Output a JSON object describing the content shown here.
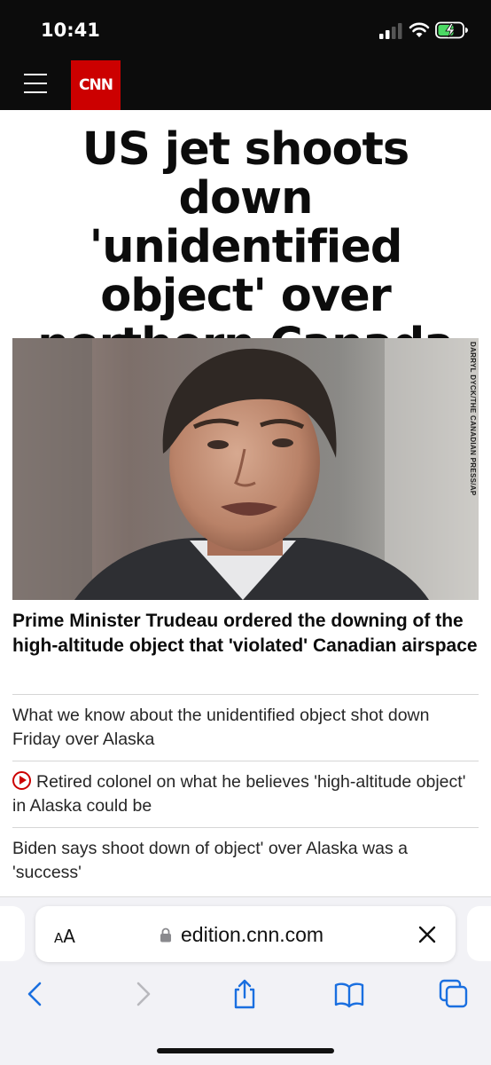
{
  "status_bar": {
    "time": "10:41"
  },
  "header": {
    "logo_text": "CNN",
    "accent": "#cc0000"
  },
  "article": {
    "headline": "US jet shoots down 'unidentified object' over northern Canada",
    "photo_credit": "DARRYL DYCK/THE CANADIAN PRESS/AP",
    "caption": "Prime Minister Trudeau ordered the downing of the high-altitude object that 'violated' Canadian airspace",
    "related": [
      {
        "text": "What we know about the unidentified object shot down Friday over Alaska",
        "video": false
      },
      {
        "text": "Retired colonel on what he believes 'high-altitude object' in Alaska could be",
        "video": true
      },
      {
        "text": "Biden says shoot down of object' over Alaska was a 'success'",
        "video": false
      }
    ]
  },
  "browser": {
    "text_size_label": "AA",
    "url": "edition.cnn.com",
    "tint": "#1a6fe0",
    "toolbar": [
      "back-icon",
      "forward-icon",
      "share-icon",
      "bookmarks-icon",
      "tabs-icon"
    ]
  }
}
